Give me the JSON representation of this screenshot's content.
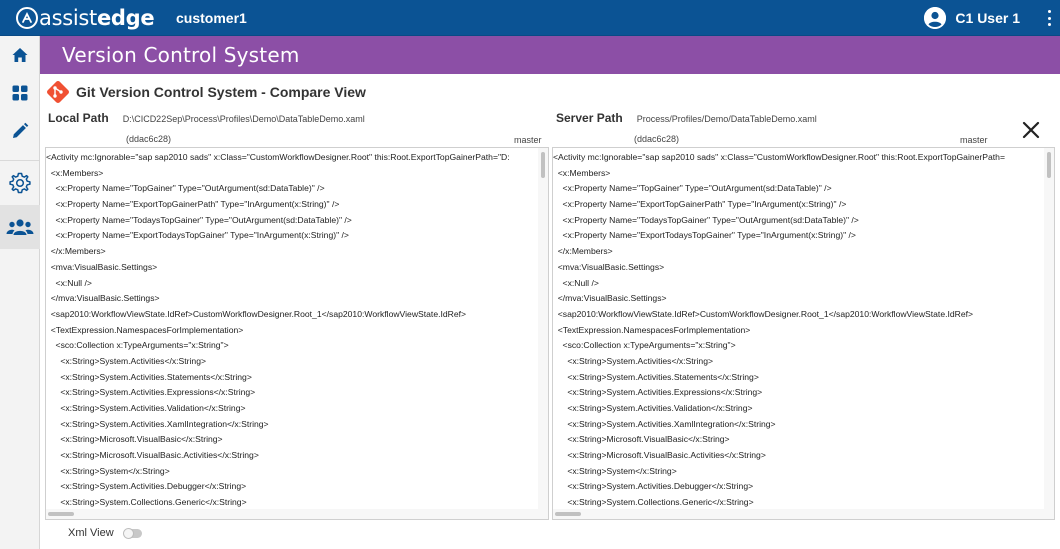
{
  "app": {
    "logo_plain": "assist",
    "logo_bold": "edge",
    "tenant": "customer1",
    "user_name": "C1 User 1",
    "brand_color": "#0b5394",
    "accent_color": "#8c4fa6"
  },
  "sidebar": {
    "items": [
      {
        "icon": "home-icon"
      },
      {
        "icon": "dashboard-icon"
      },
      {
        "icon": "pencil-icon"
      },
      {
        "icon": "gear-icon"
      },
      {
        "icon": "users-icon"
      }
    ]
  },
  "page": {
    "title": "Version Control System"
  },
  "compare": {
    "title": "Git Version Control System - Compare View",
    "local": {
      "label": "Local Path",
      "path": "D:\\CICD22Sep\\Process\\Profiles\\Demo\\DataTableDemo.xaml",
      "hash": "(ddac6c28)",
      "branch": "master"
    },
    "server": {
      "label": "Server Path",
      "path": "Process/Profiles/Demo/DataTableDemo.xaml",
      "hash": "(ddac6c28)",
      "branch": "master"
    }
  },
  "code_lines": [
    "<Activity mc:Ignorable=\"sap sap2010 sads\" x:Class=\"CustomWorkflowDesigner.Root\" this:Root.ExportTopGainerPath=\"D:",
    "  <x:Members>",
    "    <x:Property Name=\"TopGainer\" Type=\"OutArgument(sd:DataTable)\" />",
    "    <x:Property Name=\"ExportTopGainerPath\" Type=\"InArgument(x:String)\" />",
    "    <x:Property Name=\"TodaysTopGainer\" Type=\"OutArgument(sd:DataTable)\" />",
    "    <x:Property Name=\"ExportTodaysTopGainer\" Type=\"InArgument(x:String)\" />",
    "  </x:Members>",
    "  <mva:VisualBasic.Settings>",
    "    <x:Null />",
    "  </mva:VisualBasic.Settings>",
    "  <sap2010:WorkflowViewState.IdRef>CustomWorkflowDesigner.Root_1</sap2010:WorkflowViewState.IdRef>",
    "  <TextExpression.NamespacesForImplementation>",
    "    <sco:Collection x:TypeArguments=\"x:String\">",
    "      <x:String>System.Activities</x:String>",
    "      <x:String>System.Activities.Statements</x:String>",
    "      <x:String>System.Activities.Expressions</x:String>",
    "      <x:String>System.Activities.Validation</x:String>",
    "      <x:String>System.Activities.XamlIntegration</x:String>",
    "      <x:String>Microsoft.VisualBasic</x:String>",
    "      <x:String>Microsoft.VisualBasic.Activities</x:String>",
    "      <x:String>System</x:String>",
    "      <x:String>System.Activities.Debugger</x:String>",
    "      <x:String>System.Collections.Generic</x:String>"
  ],
  "server_first_line": "<Activity mc:Ignorable=\"sap sap2010 sads\" x:Class=\"CustomWorkflowDesigner.Root\" this:Root.ExportTopGainerPath=",
  "footer": {
    "xml_view_label": "Xml View",
    "xml_view_on": false
  }
}
